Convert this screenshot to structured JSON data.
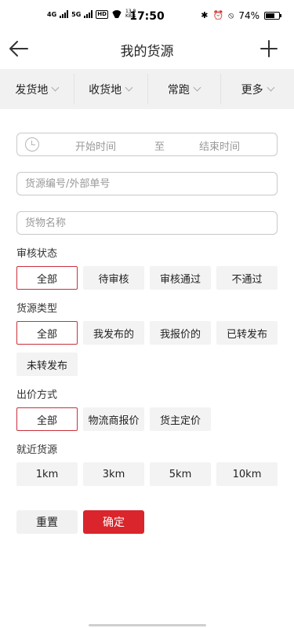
{
  "status_bar": {
    "network_left": "4G",
    "network_right": "5G",
    "hd": "HD",
    "speed_value": "13.8",
    "speed_unit": "KB/s",
    "time": "17:50",
    "battery_text": "74%",
    "battery_level": 0.74
  },
  "header": {
    "title": "我的货源"
  },
  "filter_tabs": [
    {
      "label": "发货地"
    },
    {
      "label": "收货地"
    },
    {
      "label": "常跑"
    },
    {
      "label": "更多"
    }
  ],
  "date_range": {
    "start_placeholder": "开始时间",
    "separator": "至",
    "end_placeholder": "结束时间"
  },
  "inputs": {
    "id_placeholder": "货源编号/外部单号",
    "name_placeholder": "货物名称"
  },
  "review_status": {
    "label": "审核状态",
    "options": [
      "全部",
      "待审核",
      "审核通过",
      "不通过"
    ]
  },
  "source_type": {
    "label": "货源类型",
    "options": [
      "全部",
      "我发布的",
      "我报价的",
      "已转发布",
      "未转发布"
    ]
  },
  "pricing_method": {
    "label": "出价方式",
    "options": [
      "全部",
      "物流商报价",
      "货主定价"
    ]
  },
  "nearby": {
    "label": "就近货源",
    "options": [
      "1km",
      "3km",
      "5km",
      "10km"
    ]
  },
  "actions": {
    "reset": "重置",
    "confirm": "确定"
  },
  "colors": {
    "accent": "#d9252b",
    "selected_border": "#c8313b",
    "option_bg": "#f3f3f3",
    "tab_bar_bg": "#f1f1f1"
  },
  "icons": {
    "back": "back-arrow-icon",
    "add": "plus-icon",
    "dropdown": "chevron-down-icon",
    "date": "clock-icon"
  }
}
